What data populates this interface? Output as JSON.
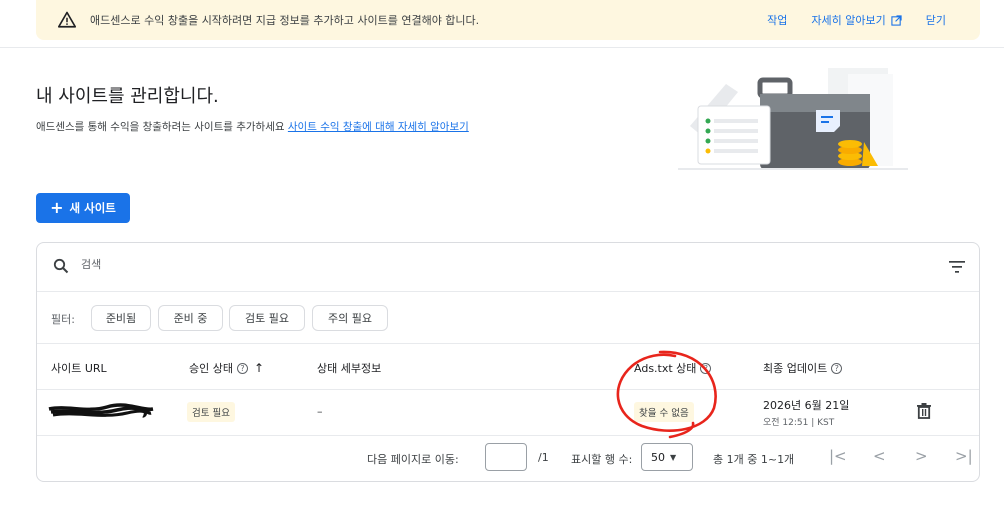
{
  "banner": {
    "message": "애드센스로 수익 창출을 시작하려면 지급 정보를 추가하고 사이트를 연결해야 합니다.",
    "action_label": "작업",
    "learn_more_label": "자세히 알아보기",
    "close_label": "닫기"
  },
  "header": {
    "title": "내 사이트를 관리합니다.",
    "subtitle": "애드센스를 통해 수익을 창출하려는 사이트를 추가하세요",
    "subtitle_link": "사이트 수익 창출에 대해 자세히 알아보기"
  },
  "new_site_label": "새 사이트",
  "search": {
    "placeholder": "검색"
  },
  "filters": {
    "label": "필터:",
    "chips": [
      "준비됨",
      "준비 중",
      "검토 필요",
      "주의 필요"
    ]
  },
  "table": {
    "columns": {
      "url": "사이트 URL",
      "approval": "승인 상태",
      "detail": "상태 세부정보",
      "adstxt": "Ads.txt 상태",
      "updated": "최종 업데이트"
    },
    "rows": [
      {
        "url": "",
        "approval": "검토 필요",
        "detail": "–",
        "adstxt": "찾을 수 없음",
        "date": "2026년 6월 21일",
        "time": "오전 12:51 | KST"
      }
    ]
  },
  "pagination": {
    "goto_label": "다음 페이지로 이동:",
    "total_pages": "/1",
    "rows_label": "표시할 행 수:",
    "rows_value": "50",
    "range": "총 1개 중 1~1개"
  },
  "colors": {
    "accent": "#1a73e8",
    "banner_bg": "#fef7e0",
    "badge_bg": "#fef7e0",
    "annotation": "#e8251c"
  }
}
